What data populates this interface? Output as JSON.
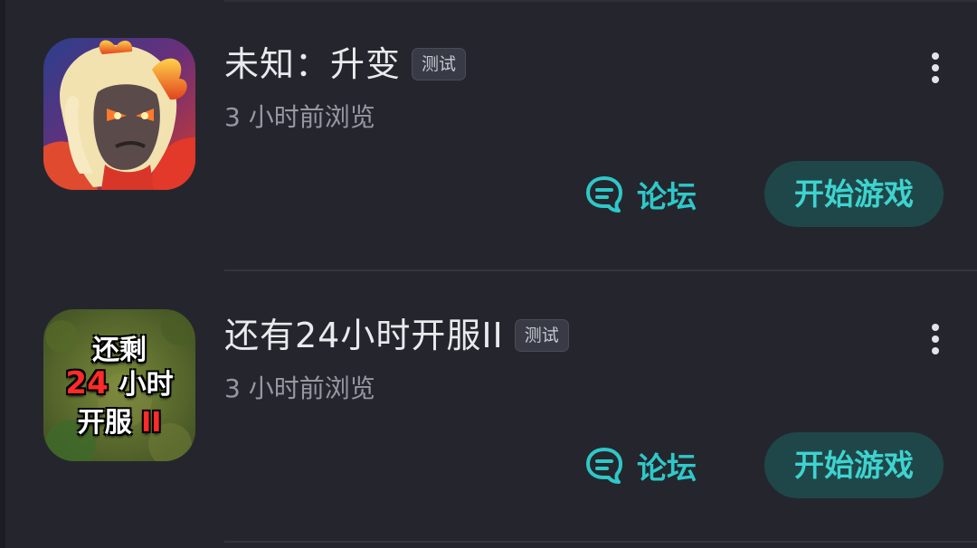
{
  "games": [
    {
      "title": "未知：升变",
      "tag": "测试",
      "subtitle": "3 小时前浏览",
      "forum_label": "论坛",
      "play_label": "开始游戏"
    },
    {
      "title": "还有24小时开服II",
      "tag": "测试",
      "subtitle": "3 小时前浏览",
      "forum_label": "论坛",
      "play_label": "开始游戏",
      "icon_text": {
        "line1": "还剩",
        "line2_num": "24",
        "line2_text": "小时",
        "line3_text": "开服",
        "line3_suffix": "II"
      }
    }
  ],
  "colors": {
    "background": "#25262d",
    "accent": "#2ec8c8",
    "play_button_bg": "#1f4749"
  }
}
